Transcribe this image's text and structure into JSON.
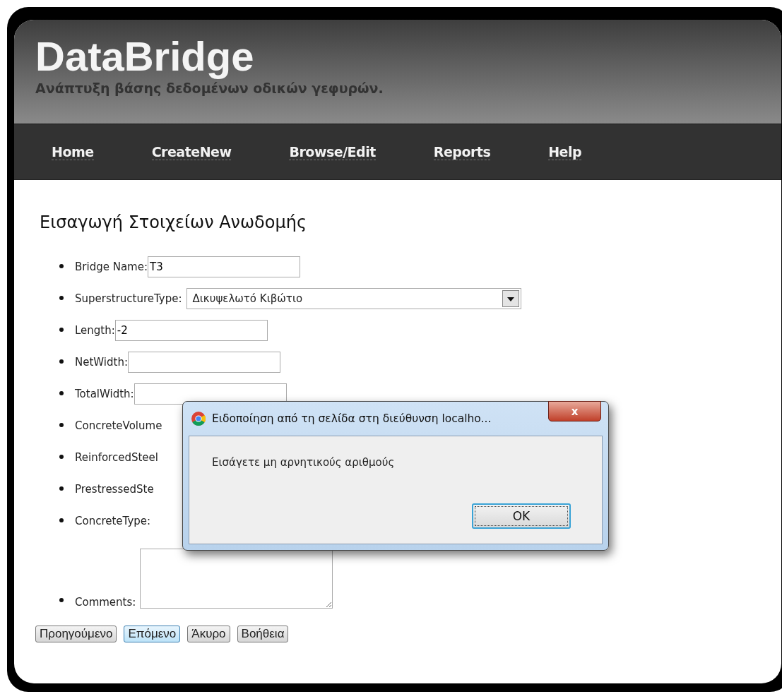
{
  "header": {
    "title": "DataBridge",
    "subtitle": "Ανάπτυξη βάσης δεδομένων οδικών γεφυρών."
  },
  "nav": [
    {
      "label": "Home"
    },
    {
      "label": "CreateNew"
    },
    {
      "label": "Browse/Edit"
    },
    {
      "label": "Reports"
    },
    {
      "label": "Help"
    }
  ],
  "form": {
    "heading": "Εισαγωγή Στοιχείων Ανωδομής",
    "fields": [
      {
        "label": "Bridge Name:",
        "kind": "text",
        "value": "T3"
      },
      {
        "label": "SuperstructureType:",
        "kind": "select",
        "value": "Δικυψελωτό Κιβώτιο"
      },
      {
        "label": "Length:",
        "kind": "text",
        "value": "-2"
      },
      {
        "label": "NetWidth:",
        "kind": "text"
      },
      {
        "label": "TotalWidth:",
        "kind": "text"
      },
      {
        "label": "ConcreteVolume",
        "kind": "hidden"
      },
      {
        "label": "ReinforcedSteel",
        "kind": "hidden"
      },
      {
        "label": "PrestressedSte",
        "kind": "hidden"
      },
      {
        "label": "ConcreteType:",
        "kind": "hidden"
      },
      {
        "label": "Comments:",
        "kind": "textarea"
      }
    ],
    "buttons": [
      {
        "label": "Προηγούμενο",
        "focused": false
      },
      {
        "label": "Επόμενο",
        "focused": true
      },
      {
        "label": "Άκυρο",
        "focused": false
      },
      {
        "label": "Βοήθεια",
        "focused": false
      }
    ]
  },
  "dialog": {
    "title": "Ειδοποίηση από τη σελίδα στη διεύθυνση localho...",
    "message": "Εισάγετε μη αρνητικούς αριθμούς",
    "button": "OK",
    "close": "x"
  }
}
